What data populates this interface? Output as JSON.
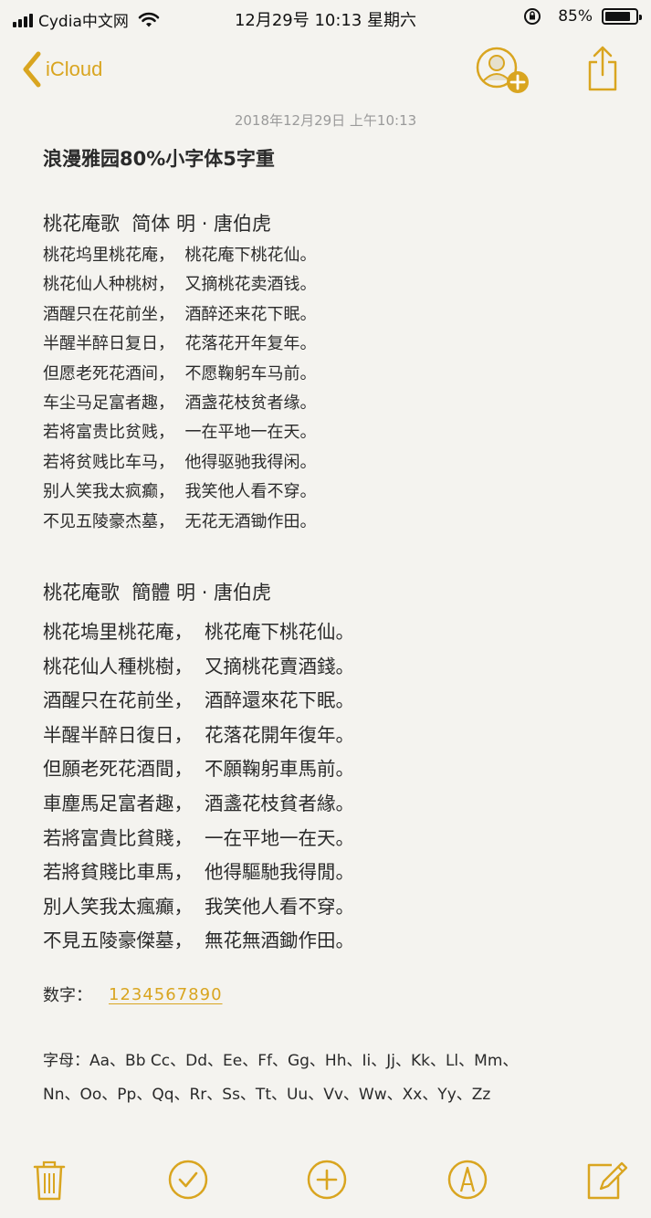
{
  "status_bar": {
    "carrier": "Cydia中文网",
    "datetime": "12月29号 10:13 星期六",
    "battery_percent": "85%",
    "battery_level": 0.85
  },
  "nav": {
    "back_label": "iCloud",
    "icons": {
      "back": "chevron-left-icon",
      "add_person": "add-person-icon",
      "share": "share-icon"
    }
  },
  "note": {
    "timestamp": "2018年12月29日 上午10:13",
    "title": "浪漫雅园80%小字体5字重",
    "sections": [
      {
        "heading": "桃花庵歌  简体 明 · 唐伯虎",
        "lines": [
          "桃花坞里桃花庵，  桃花庵下桃花仙。",
          "桃花仙人种桃树，  又摘桃花卖酒钱。",
          "酒醒只在花前坐，  酒醉还来花下眠。",
          "半醒半醉日复日，  花落花开年复年。",
          "但愿老死花酒间，  不愿鞠躬车马前。",
          "车尘马足富者趣，  酒盏花枝贫者缘。",
          "若将富贵比贫贱，  一在平地一在天。",
          "若将贫贱比车马，  他得驱驰我得闲。",
          "别人笑我太疯癫，  我笑他人看不穿。",
          "不见五陵豪杰墓，  无花无酒锄作田。"
        ]
      },
      {
        "heading": "桃花庵歌  簡體 明 · 唐伯虎",
        "lines": [
          "桃花塢里桃花庵，  桃花庵下桃花仙。",
          "桃花仙人種桃樹，  又摘桃花賣酒錢。",
          "酒醒只在花前坐，  酒醉還來花下眠。",
          "半醒半醉日復日，  花落花開年復年。",
          "但願老死花酒間，  不願鞠躬車馬前。",
          "車塵馬足富者趣，  酒盞花枝貧者緣。",
          "若將富貴比貧賤，  一在平地一在天。",
          "若將貧賤比車馬，  他得驅馳我得閒。",
          "別人笑我太瘋癲，  我笑他人看不穿。",
          "不見五陵豪傑墓，  無花無酒鋤作田。"
        ]
      }
    ],
    "digits_label": "数字：",
    "digits_value": "1234567890",
    "alphabet_line1": "字母：Aa、Bb Cc、Dd、Ee、Ff、Gg、Hh、Ii、Jj、Kk、Ll、Mm、",
    "alphabet_line2": "Nn、Oo、Pp、Qq、Rr、Ss、Tt、Uu、Vv、Ww、Xx、Yy、Zz"
  },
  "toolbar": {
    "icons": [
      "trash-icon",
      "checklist-icon",
      "new-item-icon",
      "markup-icon",
      "compose-icon"
    ]
  },
  "colors": {
    "accent": "#d9a520",
    "background": "#f4f3ef",
    "text": "#2a2a2a",
    "secondary_text": "#9a9a9a"
  }
}
